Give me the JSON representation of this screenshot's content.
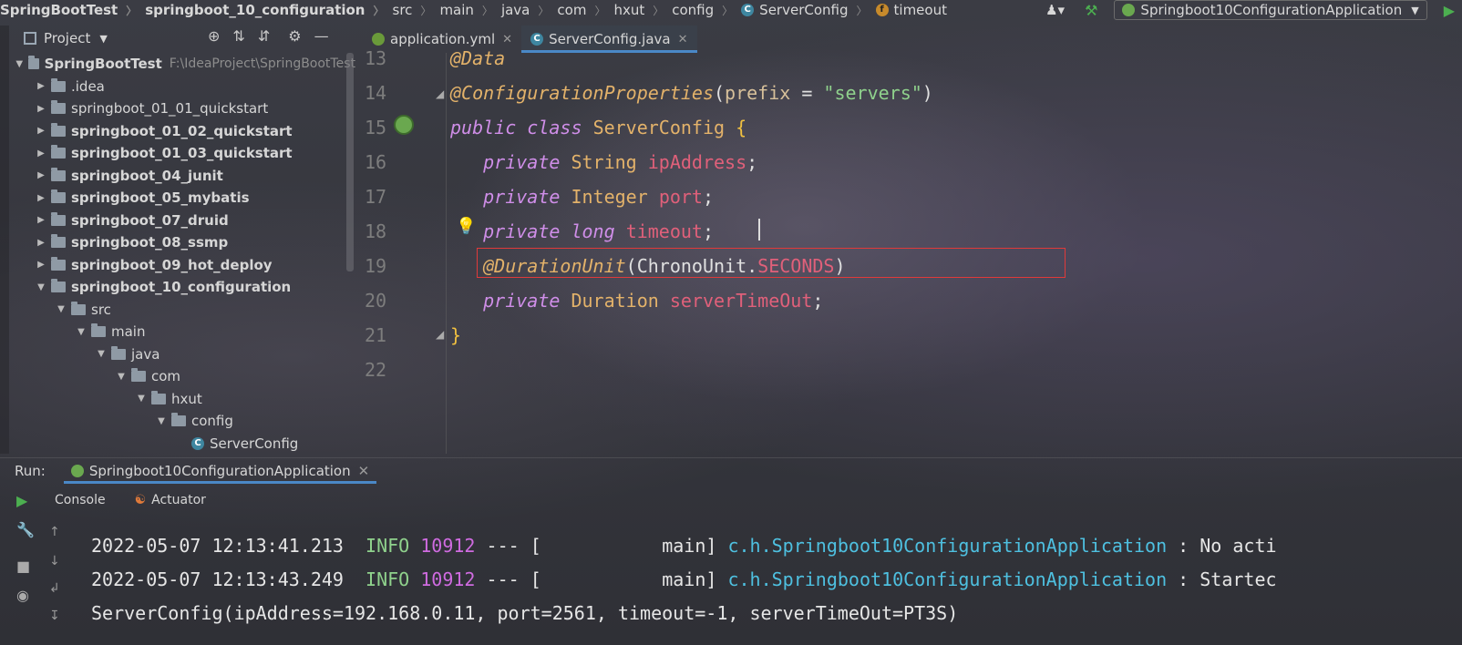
{
  "breadcrumb": {
    "items": [
      "SpringBootTest",
      "springboot_10_configuration",
      "src",
      "main",
      "java",
      "com",
      "hxut",
      "config",
      "ServerConfig",
      "timeout"
    ]
  },
  "toolbar": {
    "run_config": "Springboot10ConfigurationApplication"
  },
  "project_panel": {
    "title": "Project",
    "root": {
      "name": "SpringBootTest",
      "path": "F:\\IdeaProject\\SpringBootTest"
    },
    "items": [
      {
        "label": ".idea",
        "depth": 1,
        "expanded": false,
        "bold": false
      },
      {
        "label": "springboot_01_01_quickstart",
        "depth": 1,
        "expanded": false,
        "bold": false
      },
      {
        "label": "springboot_01_02_quickstart",
        "depth": 1,
        "expanded": false,
        "bold": true
      },
      {
        "label": "springboot_01_03_quickstart",
        "depth": 1,
        "expanded": false,
        "bold": true
      },
      {
        "label": "springboot_04_junit",
        "depth": 1,
        "expanded": false,
        "bold": true
      },
      {
        "label": "springboot_05_mybatis",
        "depth": 1,
        "expanded": false,
        "bold": true
      },
      {
        "label": "springboot_07_druid",
        "depth": 1,
        "expanded": false,
        "bold": true
      },
      {
        "label": "springboot_08_ssmp",
        "depth": 1,
        "expanded": false,
        "bold": true
      },
      {
        "label": "springboot_09_hot_deploy",
        "depth": 1,
        "expanded": false,
        "bold": true
      },
      {
        "label": "springboot_10_configuration",
        "depth": 1,
        "expanded": true,
        "bold": true
      },
      {
        "label": "src",
        "depth": 2,
        "expanded": true,
        "bold": false
      },
      {
        "label": "main",
        "depth": 3,
        "expanded": true,
        "bold": false
      },
      {
        "label": "java",
        "depth": 4,
        "expanded": true,
        "bold": false
      },
      {
        "label": "com",
        "depth": 5,
        "expanded": true,
        "bold": false
      },
      {
        "label": "hxut",
        "depth": 6,
        "expanded": true,
        "bold": false
      },
      {
        "label": "config",
        "depth": 7,
        "expanded": true,
        "bold": false
      },
      {
        "label": "ServerConfig",
        "depth": 8,
        "expanded": null,
        "bold": false
      }
    ]
  },
  "editor": {
    "tabs": [
      {
        "label": "application.yml",
        "active": false
      },
      {
        "label": "ServerConfig.java",
        "active": true
      }
    ],
    "line_numbers": [
      "13",
      "14",
      "15",
      "16",
      "17",
      "18",
      "19",
      "20",
      "21",
      "22"
    ],
    "code": {
      "l13": "@Data",
      "l14_ann": "@ConfigurationProperties",
      "l14_open": "(",
      "l14_prm": "prefix",
      "l14_eq": " = ",
      "l14_str": "\"servers\"",
      "l14_close": ")",
      "kw_public": "public",
      "kw_class": "class",
      "class_name": "ServerConfig",
      "open_brace": "{",
      "kw_private": "private",
      "t_string": "String",
      "f_ip": "ipAddress",
      "t_integer": "Integer",
      "f_port": "port",
      "kw_long": "long",
      "f_timeout": "timeout",
      "semi": ";",
      "l19_ann": "@DurationUnit",
      "l19_arg": "(ChronoUnit.",
      "l19_const": "SECONDS",
      "l19_close": ")",
      "t_duration": "Duration",
      "f_server_timeout": "serverTimeOut",
      "close_brace": "}"
    }
  },
  "run_panel": {
    "label": "Run:",
    "tab": "Springboot10ConfigurationApplication",
    "subtabs": [
      "Console",
      "Actuator"
    ],
    "lines": [
      {
        "date": "2022-05-07 12:13:41.213",
        "level": "INFO",
        "pid": "10912",
        "sep": "--- [",
        "thread": "main]",
        "logger": "c.h.Springboot10ConfigurationApplication",
        "msg": ": No acti"
      },
      {
        "date": "2022-05-07 12:13:43.249",
        "level": "INFO",
        "pid": "10912",
        "sep": "--- [",
        "thread": "main]",
        "logger": "c.h.Springboot10ConfigurationApplication",
        "msg": ": Startec"
      }
    ],
    "output": "ServerConfig(ipAddress=192.168.0.11, port=2561, timeout=-1, serverTimeOut=PT3S)"
  }
}
